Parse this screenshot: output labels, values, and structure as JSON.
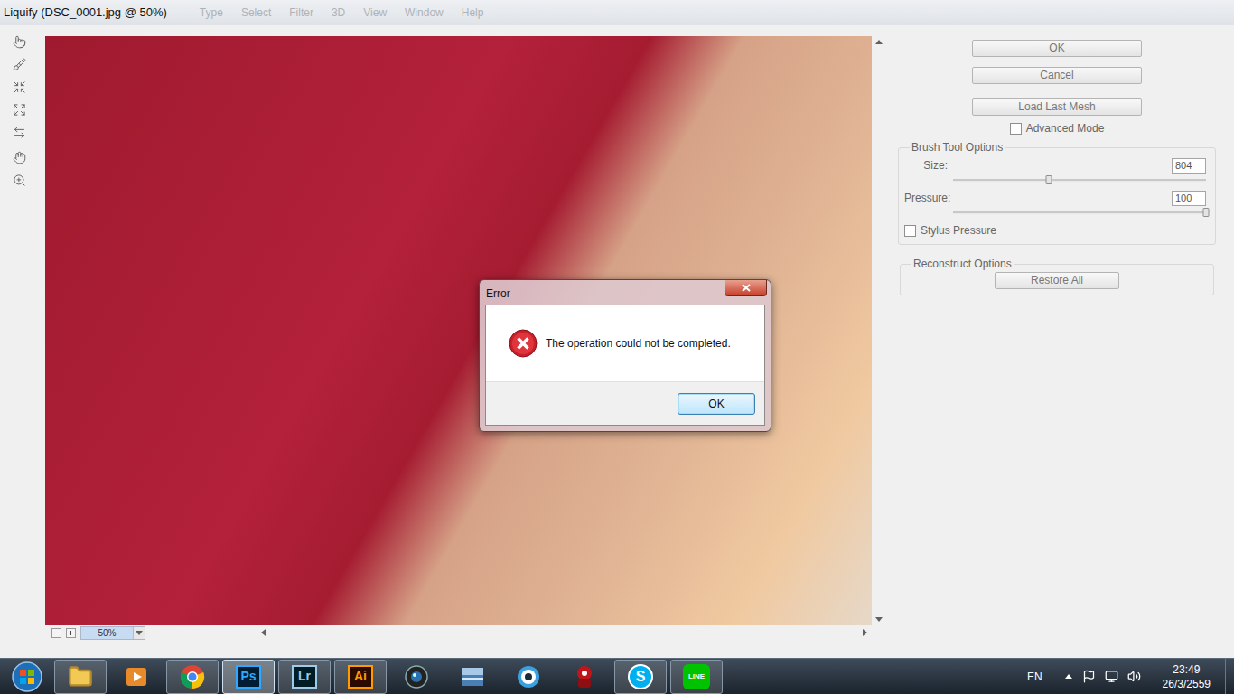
{
  "window": {
    "title": "Liquify (DSC_0001.jpg @ 50%)"
  },
  "background_menu": [
    "Type",
    "Select",
    "Filter",
    "3D",
    "View",
    "Window",
    "Help"
  ],
  "canvas": {
    "zoom": "50%"
  },
  "buttons": [
    {
      "label": "OK"
    },
    {
      "label": "Cancel"
    },
    {
      "label": "Load Last Mesh"
    }
  ],
  "advanced_mode": {
    "label": "Advanced Mode",
    "checked": false
  },
  "brush_tool_options": {
    "title": "Brush Tool Options",
    "sliders": [
      {
        "label": "Size:",
        "value": "804",
        "level": 0.38
      },
      {
        "label": "Pressure:",
        "value": "100",
        "level": 1
      }
    ],
    "stylus_pressure": {
      "label": "Stylus Pressure",
      "checked": false
    }
  },
  "reconstruct_options": {
    "title": "Reconstruct Options",
    "button": "Restore All"
  },
  "dialog": {
    "title": "Error",
    "message": "The operation could not be completed.",
    "button": "OK"
  },
  "taskbar": {
    "apps": [
      {
        "kind": "folder",
        "running": true,
        "selected": false
      },
      {
        "kind": "media",
        "running": false,
        "selected": false
      },
      {
        "kind": "chrome",
        "running": true,
        "selected": false
      },
      {
        "kind": "ps",
        "label": "Ps",
        "running": true,
        "selected": true
      },
      {
        "kind": "lr",
        "label": "Lr",
        "running": true,
        "selected": false
      },
      {
        "kind": "ai",
        "label": "Ai",
        "running": true,
        "selected": false
      },
      {
        "kind": "camera",
        "running": false,
        "selected": false
      },
      {
        "kind": "window",
        "running": false,
        "selected": false
      },
      {
        "kind": "bird",
        "running": false,
        "selected": false
      },
      {
        "kind": "game",
        "running": false,
        "selected": false
      },
      {
        "kind": "skype",
        "label": "S",
        "running": true,
        "selected": false
      },
      {
        "kind": "line",
        "label": "LINE",
        "running": true,
        "selected": false
      }
    ]
  },
  "tray": {
    "language": "EN",
    "time": "23:49",
    "date": "26/3/2559"
  }
}
